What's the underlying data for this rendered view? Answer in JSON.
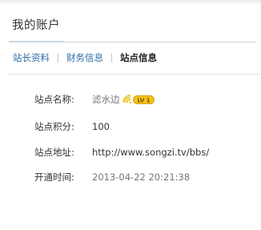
{
  "header": {
    "title": "我的账户"
  },
  "tabs": [
    {
      "label": "站长资料",
      "active": false
    },
    {
      "label": "财务信息",
      "active": false
    },
    {
      "label": "站点信息",
      "active": true
    }
  ],
  "site_info": {
    "name": {
      "label": "站点名称:",
      "value": "滤水边",
      "level_badge": "LV 1"
    },
    "points": {
      "label": "站点积分:",
      "value": "100"
    },
    "address": {
      "label": "站点地址:",
      "value": "http://www.songzi.tv/bbs/"
    },
    "opened": {
      "label": "开通时间:",
      "value": "2013-04-22 20:21:38"
    }
  },
  "colors": {
    "link": "#2b6aa6",
    "rule": "#c9d5e2",
    "badge_gold": "#f2c21b",
    "badge_text": "#7a4e00"
  },
  "icons": {
    "level": "signal-level-icon"
  }
}
